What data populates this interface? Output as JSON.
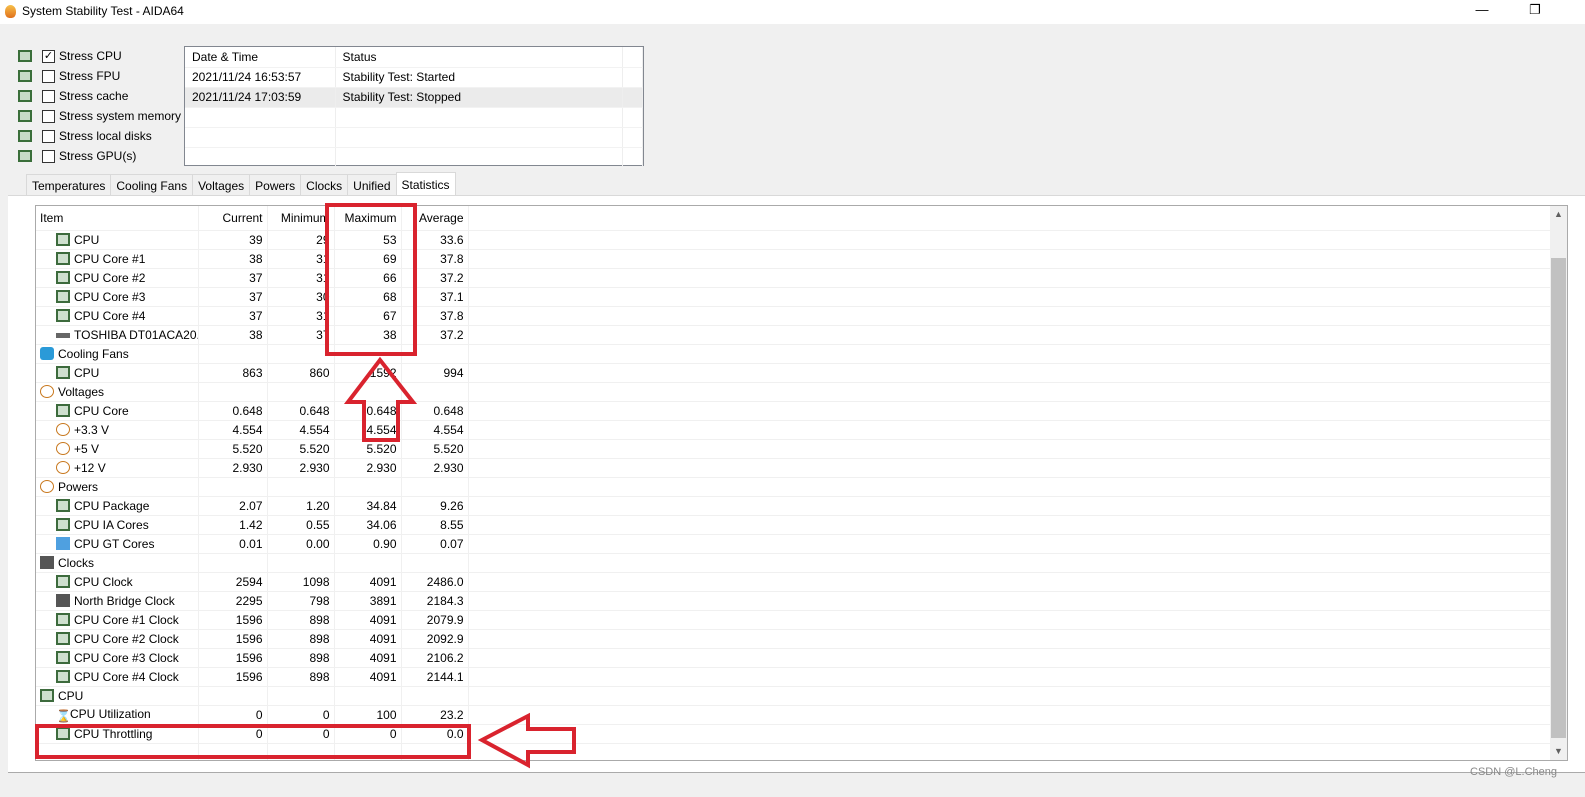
{
  "window": {
    "title": "System Stability Test - AIDA64",
    "minimize": "—",
    "restore": "❐"
  },
  "stress": [
    {
      "label": "Stress CPU",
      "checked": true,
      "icon": "cpu-icon"
    },
    {
      "label": "Stress FPU",
      "checked": false,
      "icon": "fpu-icon"
    },
    {
      "label": "Stress cache",
      "checked": false,
      "icon": "cache-icon"
    },
    {
      "label": "Stress system memory",
      "checked": false,
      "icon": "memory-icon"
    },
    {
      "label": "Stress local disks",
      "checked": false,
      "icon": "disk-icon"
    },
    {
      "label": "Stress GPU(s)",
      "checked": false,
      "icon": "gpu-icon"
    }
  ],
  "log": {
    "headers": [
      "Date & Time",
      "Status"
    ],
    "rows": [
      [
        "2021/11/24 16:53:57",
        "Stability Test: Started"
      ],
      [
        "2021/11/24 17:03:59",
        "Stability Test: Stopped"
      ]
    ]
  },
  "tabs": [
    "Temperatures",
    "Cooling Fans",
    "Voltages",
    "Powers",
    "Clocks",
    "Unified",
    "Statistics"
  ],
  "active_tab": "Statistics",
  "stats": {
    "headers": [
      "Item",
      "Current",
      "Minimum",
      "Maximum",
      "Average"
    ],
    "rows": [
      {
        "item": "CPU",
        "icon": "cpu",
        "vals": [
          "39",
          "29",
          "53",
          "33.6"
        ]
      },
      {
        "item": "CPU Core #1",
        "icon": "cpu",
        "vals": [
          "38",
          "31",
          "69",
          "37.8"
        ]
      },
      {
        "item": "CPU Core #2",
        "icon": "cpu",
        "vals": [
          "37",
          "31",
          "66",
          "37.2"
        ]
      },
      {
        "item": "CPU Core #3",
        "icon": "cpu",
        "vals": [
          "37",
          "30",
          "68",
          "37.1"
        ]
      },
      {
        "item": "CPU Core #4",
        "icon": "cpu",
        "vals": [
          "37",
          "31",
          "67",
          "37.8"
        ]
      },
      {
        "item": "TOSHIBA DT01ACA20...",
        "icon": "disk",
        "vals": [
          "38",
          "37",
          "38",
          "37.2"
        ]
      },
      {
        "item": "Cooling Fans",
        "icon": "fan",
        "group": true
      },
      {
        "item": "CPU",
        "icon": "cpu",
        "vals": [
          "863",
          "860",
          "1592",
          "994"
        ]
      },
      {
        "item": "Voltages",
        "icon": "bolt",
        "group": true
      },
      {
        "item": "CPU Core",
        "icon": "cpu",
        "vals": [
          "0.648",
          "0.648",
          "0.648",
          "0.648"
        ]
      },
      {
        "item": "+3.3 V",
        "icon": "bolt",
        "vals": [
          "4.554",
          "4.554",
          "4.554",
          "4.554"
        ]
      },
      {
        "item": "+5 V",
        "icon": "bolt",
        "vals": [
          "5.520",
          "5.520",
          "5.520",
          "5.520"
        ]
      },
      {
        "item": "+12 V",
        "icon": "bolt",
        "vals": [
          "2.930",
          "2.930",
          "2.930",
          "2.930"
        ]
      },
      {
        "item": "Powers",
        "icon": "bolt",
        "group": true
      },
      {
        "item": "CPU Package",
        "icon": "cpu",
        "vals": [
          "2.07",
          "1.20",
          "34.84",
          "9.26"
        ]
      },
      {
        "item": "CPU IA Cores",
        "icon": "cpu",
        "vals": [
          "1.42",
          "0.55",
          "34.06",
          "8.55"
        ]
      },
      {
        "item": "CPU GT Cores",
        "icon": "gpu",
        "vals": [
          "0.01",
          "0.00",
          "0.90",
          "0.07"
        ]
      },
      {
        "item": "Clocks",
        "icon": "clock",
        "group": true
      },
      {
        "item": "CPU Clock",
        "icon": "cpu",
        "vals": [
          "2594",
          "1098",
          "4091",
          "2486.0"
        ]
      },
      {
        "item": "North Bridge Clock",
        "icon": "clock",
        "vals": [
          "2295",
          "798",
          "3891",
          "2184.3"
        ]
      },
      {
        "item": "CPU Core #1 Clock",
        "icon": "cpu",
        "vals": [
          "1596",
          "898",
          "4091",
          "2079.9"
        ]
      },
      {
        "item": "CPU Core #2 Clock",
        "icon": "cpu",
        "vals": [
          "1596",
          "898",
          "4091",
          "2092.9"
        ]
      },
      {
        "item": "CPU Core #3 Clock",
        "icon": "cpu",
        "vals": [
          "1596",
          "898",
          "4091",
          "2106.2"
        ]
      },
      {
        "item": "CPU Core #4 Clock",
        "icon": "cpu",
        "vals": [
          "1596",
          "898",
          "4091",
          "2144.1"
        ]
      },
      {
        "item": "CPU",
        "icon": "cpu",
        "group": true
      },
      {
        "item": "CPU Utilization",
        "icon": "hour",
        "vals": [
          "0",
          "0",
          "100",
          "23.2"
        ]
      },
      {
        "item": "CPU Throttling",
        "icon": "cpu",
        "vals": [
          "0",
          "0",
          "0",
          "0.0"
        ]
      }
    ]
  },
  "watermark": "CSDN @L.Cheng",
  "colors": {
    "annotation": "#d9232e",
    "cpu_icon": "#3d6b3d",
    "selection": "#ebebeb"
  }
}
